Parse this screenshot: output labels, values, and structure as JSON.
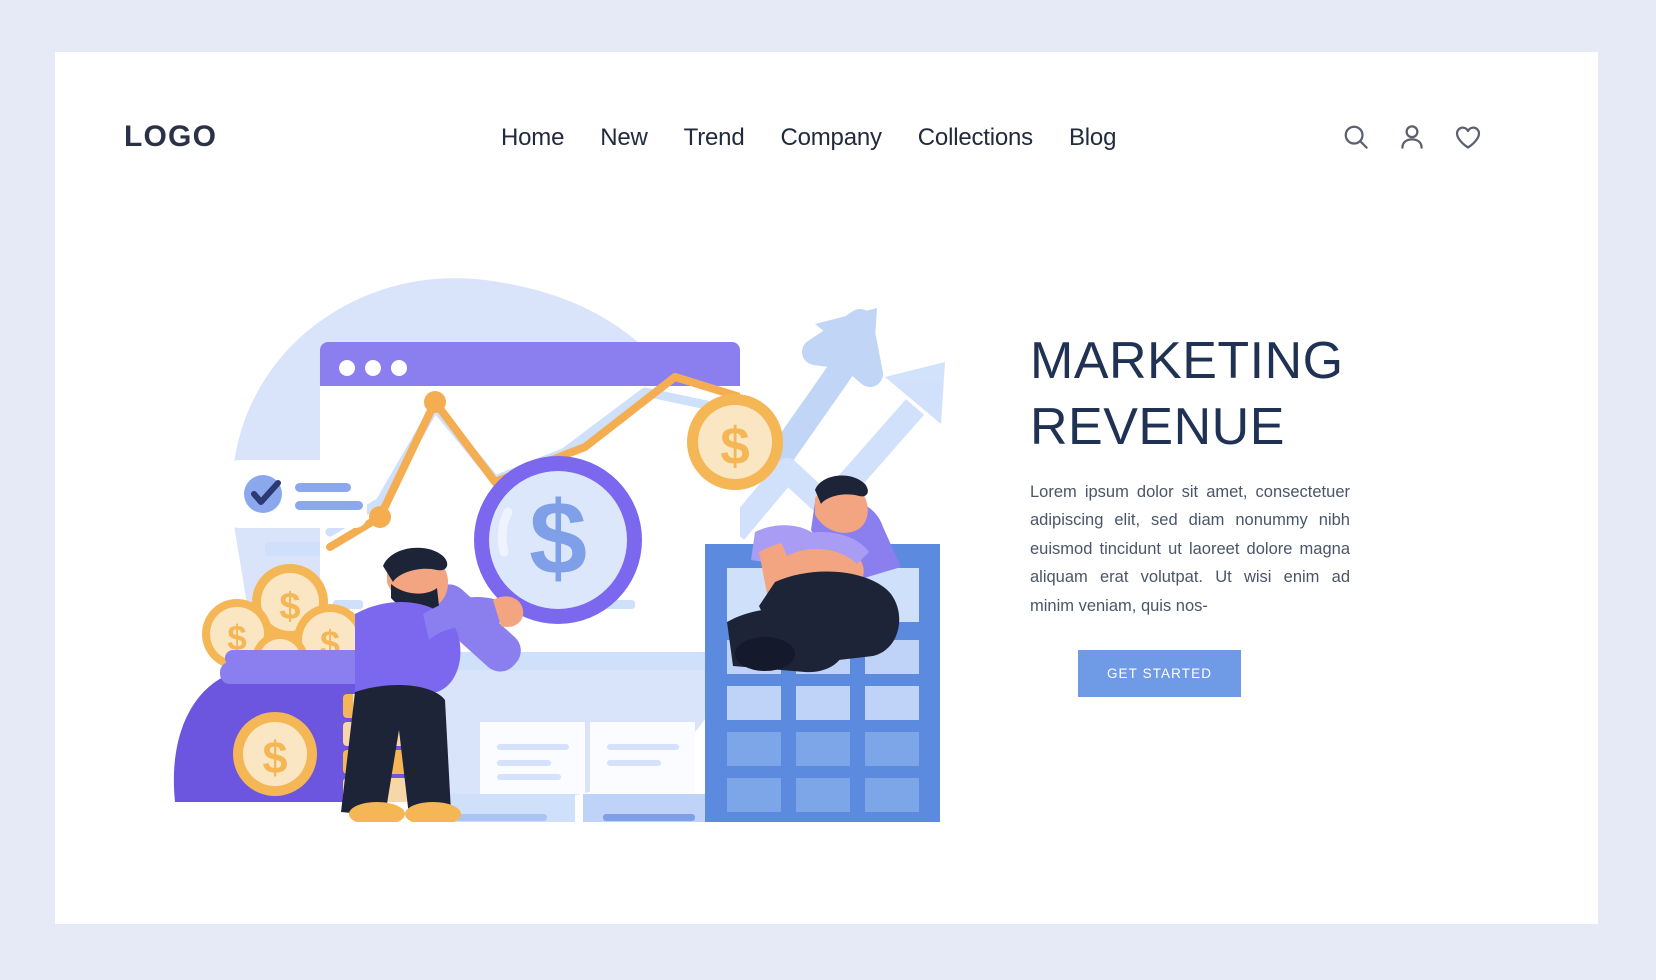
{
  "brand": {
    "logo_text": "LOGO"
  },
  "nav": {
    "items": [
      {
        "label": "Home"
      },
      {
        "label": "New"
      },
      {
        "label": "Trend"
      },
      {
        "label": "Company"
      },
      {
        "label": "Collections"
      },
      {
        "label": "Blog"
      }
    ]
  },
  "header_icons": [
    {
      "name": "search-icon"
    },
    {
      "name": "user-icon"
    },
    {
      "name": "heart-icon"
    }
  ],
  "hero": {
    "title": "MARKETING REVENUE",
    "paragraph": "Lorem ipsum dolor sit amet, consectetuer adipiscing elit, sed diam nonummy nibh euismod tincidunt ut laoreet dolore magna aliquam erat volutpat. Ut wisi enim ad minim veniam, quis nos-",
    "cta_label": "GET STARTED"
  },
  "illustration": {
    "alt": "Two businessmen analyzing marketing revenue with magnifier, coins, money bag, calculator and growth charts",
    "elements": [
      "browser-window",
      "line-chart",
      "magnifier-dollar",
      "gold-coin",
      "money-bag",
      "coin-stack",
      "calculator",
      "documents",
      "growth-arrows",
      "checklist-card",
      "character-left",
      "character-right"
    ]
  },
  "colors": {
    "page_background": "#e5eaf6",
    "card_background": "#ffffff",
    "accent_purple": "#7b68ee",
    "accent_blue": "#6f9ae6",
    "accent_orange": "#f5a947",
    "text_dark": "#1f3253",
    "text_body": "#4a5568",
    "pale_blue": "#d6e2fb"
  }
}
